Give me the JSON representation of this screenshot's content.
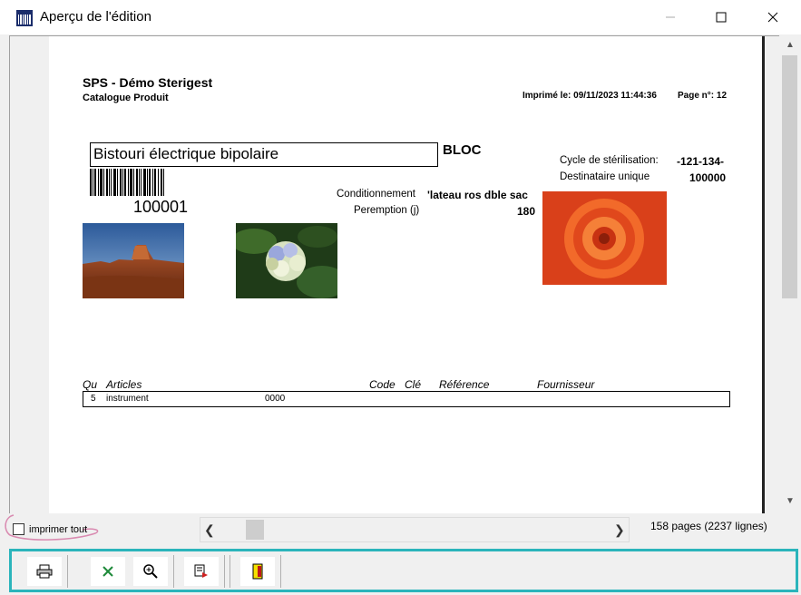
{
  "window": {
    "title": "Aperçu de l'édition",
    "controls": {
      "minimize": "—",
      "maximize": "☐",
      "close": "✕"
    }
  },
  "report": {
    "company": "SPS - Démo Sterigest",
    "catalog": "Catalogue Produit",
    "printed_label": "Imprimé le: 09/11/2023 11:44:36",
    "page_label": "Page n°: 12",
    "product_name": "Bistouri électrique bipolaire",
    "bloc": "BLOC",
    "product_code": "100001",
    "conditionnement_label": "Conditionnement",
    "conditionnement_value": "'lateau ros dble sac",
    "peremption_label": "Peremption (j)",
    "peremption_value": "180",
    "cycle_label": "Cycle de stérilisation:",
    "cycle_value": "-121-134-",
    "destinataire_label": "Destinataire unique",
    "destinataire_value": "100000",
    "table": {
      "headers": {
        "qu": "Qu",
        "articles": "Articles",
        "code": "Code",
        "cle": "Clé",
        "reference": "Référence",
        "fournisseur": "Fournisseur"
      },
      "rows": [
        {
          "qu": "5",
          "article": "instrument",
          "code": "0000"
        }
      ]
    }
  },
  "bottom": {
    "print_all_label": "imprimer tout",
    "pages_info": "158 pages (2237 lignes)"
  },
  "toolbar": {
    "buttons": [
      "print-icon",
      "excel-icon",
      "zoom-icon",
      "export-icon",
      "exit-icon"
    ]
  },
  "colors": {
    "toolbar_border": "#2bb4bb",
    "circle": "#d98ab0"
  }
}
